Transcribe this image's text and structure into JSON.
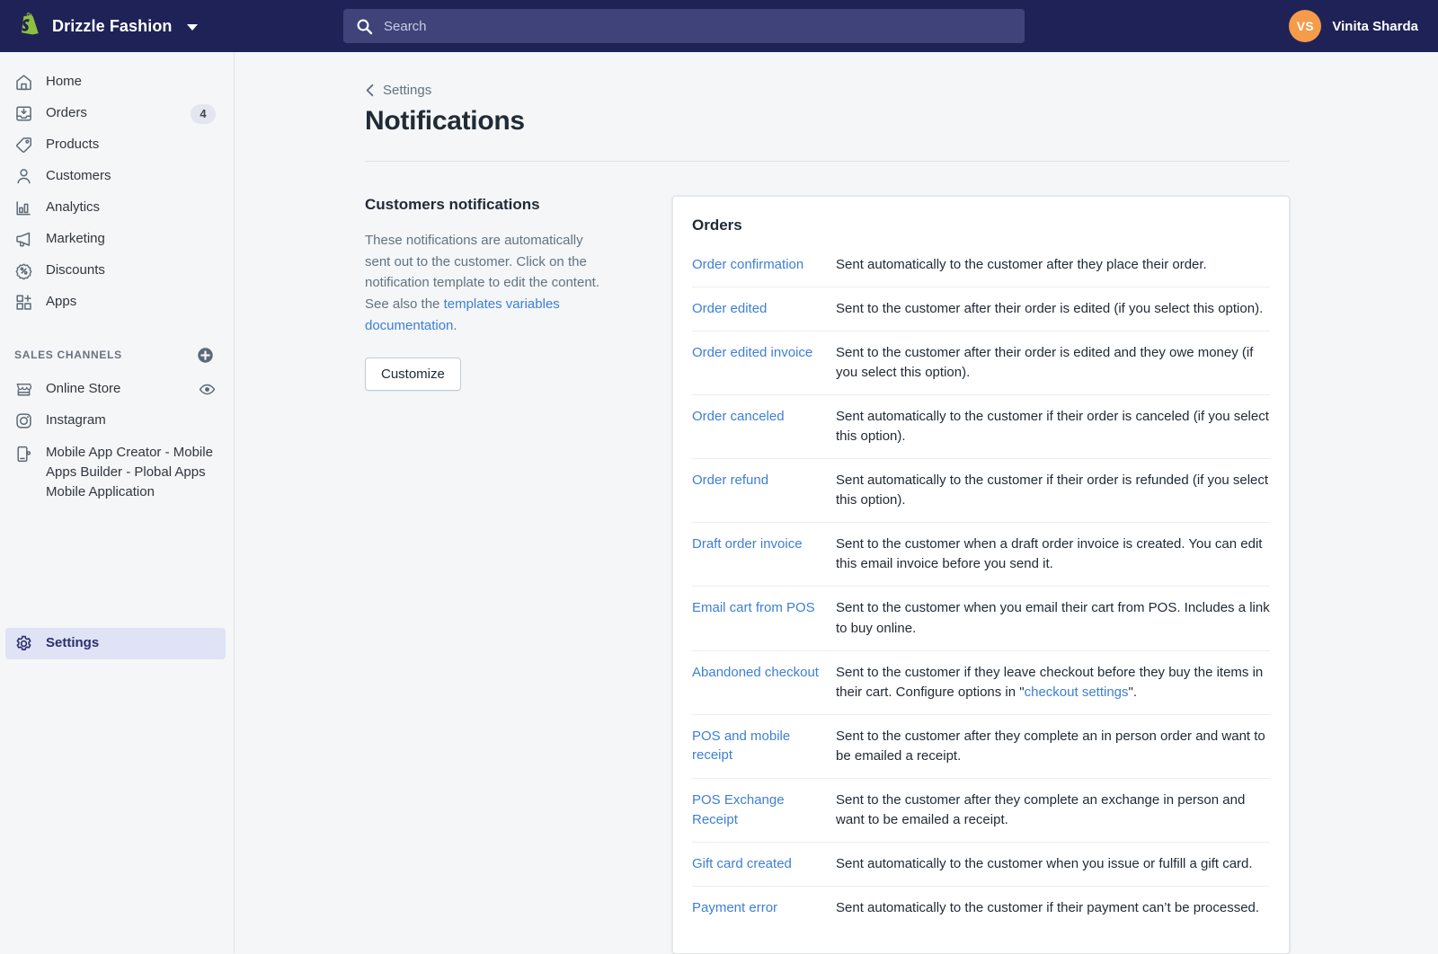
{
  "topbar": {
    "logo_icon": "shopify-bag-icon",
    "store_name": "Drizzle Fashion",
    "store_caret_icon": "chevron-down-icon",
    "search": {
      "icon": "search-icon",
      "placeholder": "Search",
      "value": ""
    },
    "user": {
      "initials": "VS",
      "name": "Vinita Sharda"
    },
    "colors": {
      "bar_background": "#1f2257",
      "search_background": "#3f437a",
      "avatar_background": "#f59b4a"
    }
  },
  "sidebar": {
    "items": [
      {
        "label": "Home",
        "icon": "home-icon",
        "badge": null,
        "active": false
      },
      {
        "label": "Orders",
        "icon": "orders-inbox-icon",
        "badge": "4",
        "active": false
      },
      {
        "label": "Products",
        "icon": "product-tag-icon",
        "badge": null,
        "active": false
      },
      {
        "label": "Customers",
        "icon": "person-icon",
        "badge": null,
        "active": false
      },
      {
        "label": "Analytics",
        "icon": "bar-chart-icon",
        "badge": null,
        "active": false
      },
      {
        "label": "Marketing",
        "icon": "megaphone-icon",
        "badge": null,
        "active": false
      },
      {
        "label": "Discounts",
        "icon": "discount-percent-icon",
        "badge": null,
        "active": false
      },
      {
        "label": "Apps",
        "icon": "apps-grid-plus-icon",
        "badge": null,
        "active": false
      }
    ],
    "sales_channels": {
      "title": "SALES CHANNELS",
      "add_icon": "plus-circle-icon",
      "items": [
        {
          "label": "Online Store",
          "icon": "storefront-icon",
          "trailing_icon": "eye-icon"
        },
        {
          "label": "Instagram",
          "icon": "instagram-icon",
          "trailing_icon": null
        },
        {
          "label": "Mobile App Creator - Mobile Apps Builder - Plobal Apps Mobile Application",
          "icon": "mobile-phone-icon",
          "trailing_icon": null
        }
      ]
    },
    "settings": {
      "label": "Settings",
      "icon": "gear-icon",
      "active": true
    }
  },
  "main": {
    "breadcrumb": {
      "icon": "chevron-left-icon",
      "label": "Settings"
    },
    "page_title": "Notifications",
    "left_column": {
      "title": "Customers notifications",
      "description_part1": "These notifications are automatically sent out to the customer. Click on the notification template to edit the content. See also the ",
      "description_link": "templates variables documentation",
      "description_part2": ".",
      "customize_button": "Customize"
    },
    "card": {
      "title": "Orders",
      "rows": [
        {
          "label": "Order confirmation",
          "desc": "Sent automatically to the customer after they place their order."
        },
        {
          "label": "Order edited",
          "desc": "Sent to the customer after their order is edited (if you select this option)."
        },
        {
          "label": "Order edited invoice",
          "desc": "Sent to the customer after their order is edited and they owe money (if you select this option)."
        },
        {
          "label": "Order canceled",
          "desc": "Sent automatically to the customer if their order is canceled (if you select this option)."
        },
        {
          "label": "Order refund",
          "desc": "Sent automatically to the customer if their order is refunded (if you select this option)."
        },
        {
          "label": "Draft order invoice",
          "desc": "Sent to the customer when a draft order invoice is created. You can edit this email invoice before you send it."
        },
        {
          "label": "Email cart from POS",
          "desc": "Sent to the customer when you email their cart from POS. Includes a link to buy online."
        },
        {
          "label": "Abandoned checkout",
          "desc_part1": "Sent to the customer if they leave checkout before they buy the items in their cart. Configure options in \"",
          "desc_link": "checkout settings",
          "desc_part2": "\"."
        },
        {
          "label": "POS and mobile receipt",
          "desc": "Sent to the customer after they complete an in person order and want to be emailed a receipt."
        },
        {
          "label": "POS Exchange Receipt",
          "desc": "Sent to the customer after they complete an exchange in person and want to be emailed a receipt."
        },
        {
          "label": "Gift card created",
          "desc": "Sent automatically to the customer when you issue or fulfill a gift card."
        },
        {
          "label": "Payment error",
          "desc": "Sent automatically to the customer if their payment can’t be processed."
        }
      ]
    }
  },
  "colors": {
    "link": "#3d7fd4",
    "page_background": "#f4f6f8",
    "text": "#212b36",
    "muted_text": "#637381"
  }
}
